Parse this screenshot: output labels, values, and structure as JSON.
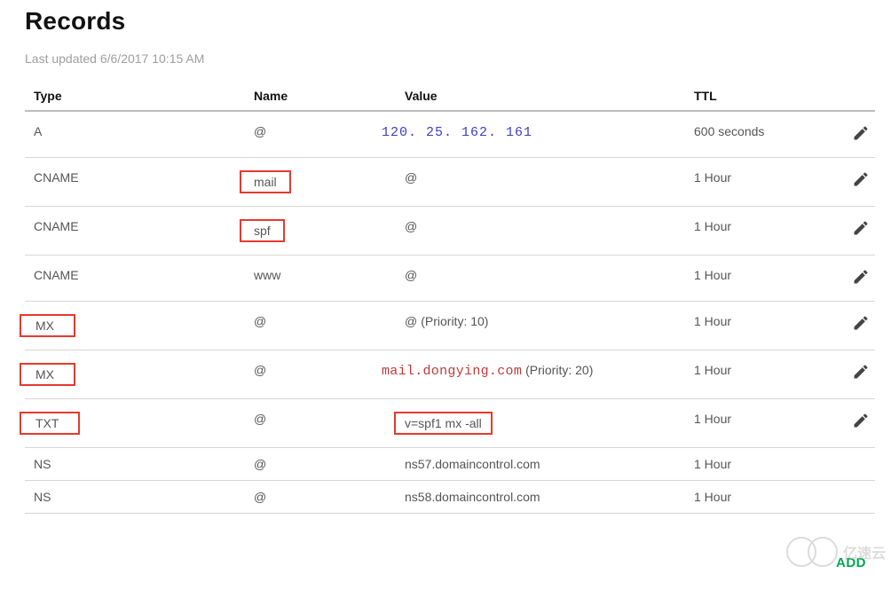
{
  "page": {
    "title": "Records",
    "last_updated": "Last updated 6/6/2017 10:15 AM",
    "add_label": "ADD"
  },
  "columns": {
    "type": "Type",
    "name": "Name",
    "value": "Value",
    "ttl": "TTL"
  },
  "rows": [
    {
      "type": "A",
      "type_hl": false,
      "name": "@",
      "name_hl": false,
      "value": "120. 25. 162. 161",
      "value_style": "blue",
      "value_hl": false,
      "value_suffix": "",
      "ttl": "600 seconds",
      "editable": true,
      "tight": false
    },
    {
      "type": "CNAME",
      "type_hl": false,
      "name": "mail",
      "name_hl": true,
      "value": "@",
      "value_style": "",
      "value_hl": false,
      "value_suffix": "",
      "ttl": "1 Hour",
      "editable": true,
      "tight": false
    },
    {
      "type": "CNAME",
      "type_hl": false,
      "name": "spf",
      "name_hl": true,
      "value": "@",
      "value_style": "",
      "value_hl": false,
      "value_suffix": "",
      "ttl": "1 Hour",
      "editable": true,
      "tight": false
    },
    {
      "type": "CNAME",
      "type_hl": false,
      "name": "www",
      "name_hl": false,
      "value": "@",
      "value_style": "",
      "value_hl": false,
      "value_suffix": "",
      "ttl": "1 Hour",
      "editable": true,
      "tight": false
    },
    {
      "type": "MX",
      "type_hl": true,
      "name": "@",
      "name_hl": false,
      "value": "@",
      "value_style": "",
      "value_hl": false,
      "value_suffix": "(Priority: 10)",
      "ttl": "1 Hour",
      "editable": true,
      "tight": false
    },
    {
      "type": "MX",
      "type_hl": true,
      "name": "@",
      "name_hl": false,
      "value": "mail.dongying.com",
      "value_style": "red",
      "value_hl": false,
      "value_suffix": "(Priority: 20)",
      "ttl": "1 Hour",
      "editable": true,
      "tight": false
    },
    {
      "type": "TXT",
      "type_hl": true,
      "name": "@",
      "name_hl": false,
      "value": "v=spf1 mx -all",
      "value_style": "",
      "value_hl": true,
      "value_suffix": "",
      "ttl": "1 Hour",
      "editable": true,
      "tight": false
    },
    {
      "type": "NS",
      "type_hl": false,
      "name": "@",
      "name_hl": false,
      "value": "ns57.domaincontrol.com",
      "value_style": "",
      "value_hl": false,
      "value_suffix": "",
      "ttl": "1 Hour",
      "editable": false,
      "tight": true
    },
    {
      "type": "NS",
      "type_hl": false,
      "name": "@",
      "name_hl": false,
      "value": "ns58.domaincontrol.com",
      "value_style": "",
      "value_hl": false,
      "value_suffix": "",
      "ttl": "1 Hour",
      "editable": false,
      "tight": true
    }
  ],
  "watermark": "亿速云"
}
